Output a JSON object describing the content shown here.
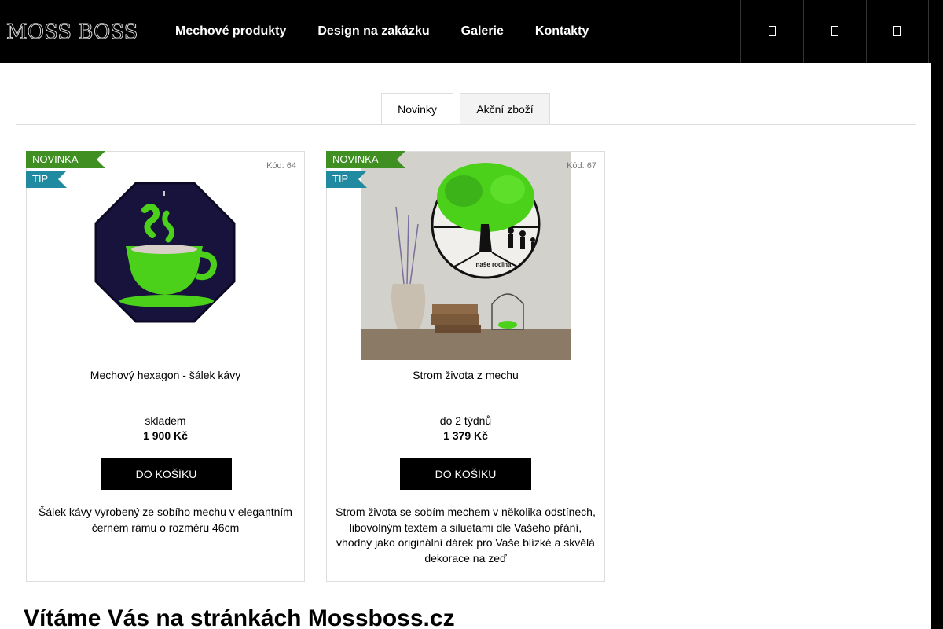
{
  "header": {
    "logo": "MOSS BOSS",
    "nav": [
      "Mechové produkty",
      "Design na zakázku",
      "Galerie",
      "Kontakty"
    ],
    "icons": [
      "search-icon",
      "user-icon",
      "cart-icon"
    ]
  },
  "tabs": [
    {
      "label": "Novinky",
      "active": true
    },
    {
      "label": "Akční zboží",
      "active": false
    }
  ],
  "products": [
    {
      "flag_new": "NOVINKA",
      "flag_tip": "TIP",
      "code": "Kód: 64",
      "name": "Mechový hexagon - šálek kávy",
      "availability": "skladem",
      "price": "1 900 Kč",
      "button": "DO KOŠÍKU",
      "description": "Šálek kávy vyrobený ze sobího mechu v elegantním černém rámu o rozměru 46cm"
    },
    {
      "flag_new": "NOVINKA",
      "flag_tip": "TIP",
      "code": "Kód: 67",
      "name": "Strom života z mechu",
      "availability": "do 2 týdnů",
      "price": "1 379 Kč",
      "button": "DO KOŠÍKU",
      "description": "Strom života se sobím mechem v několika odstínech, libovolným textem a siluetami dle Vašeho přání, vhodný jako originální dárek pro Vaše blízké a skvělá dekorace na zeď",
      "image_caption": "naše rodina"
    }
  ],
  "welcome": "Vítáme Vás na stránkách Mossboss.cz",
  "colors": {
    "flag_new": "#3f8f22",
    "flag_tip": "#1f8aa0",
    "moss": "#4cd11a"
  }
}
